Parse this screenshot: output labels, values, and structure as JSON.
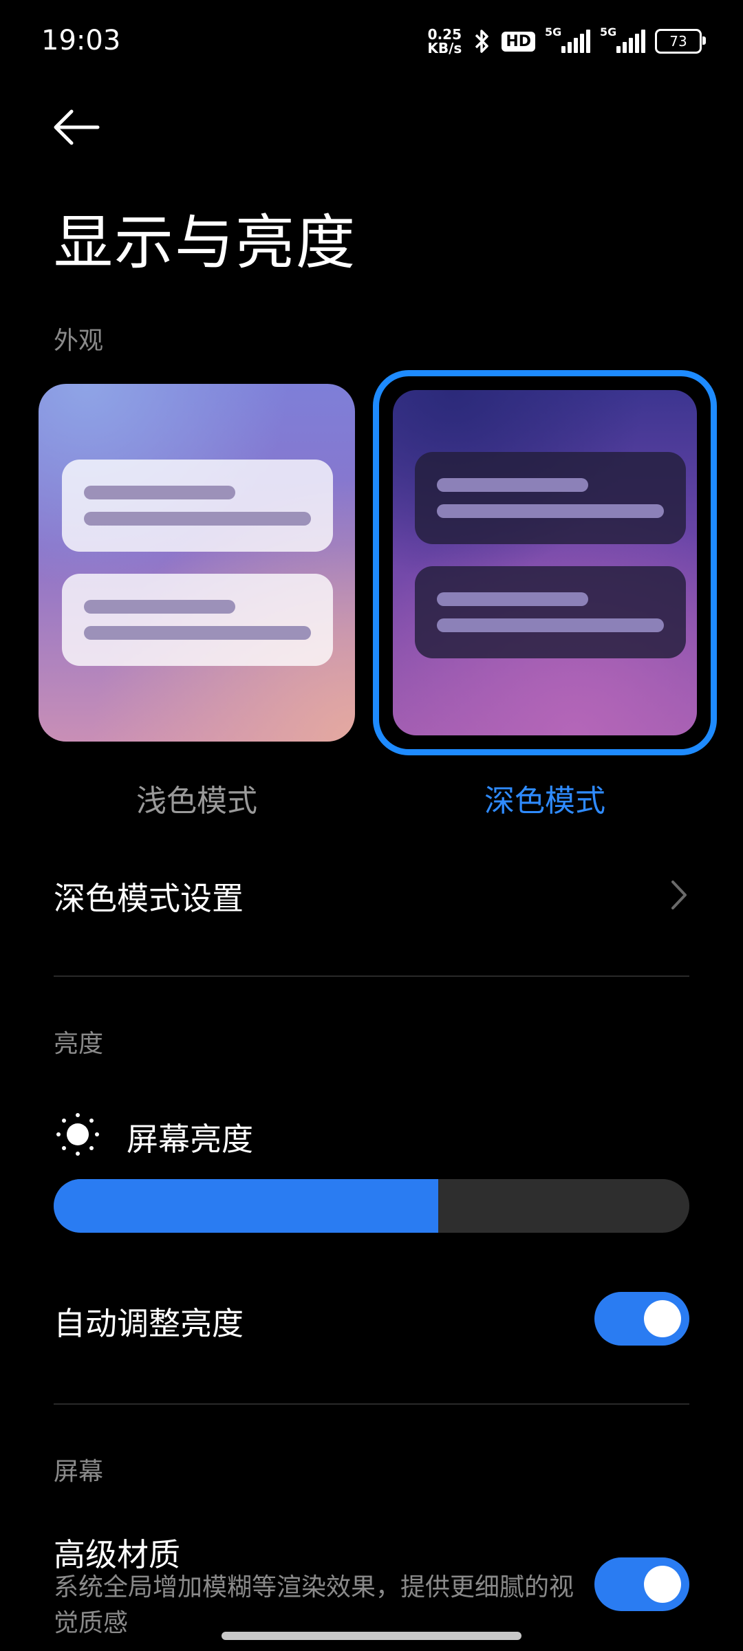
{
  "status_bar": {
    "time": "19:03",
    "speed_value": "0.25",
    "speed_unit": "KB/s",
    "hd_badge": "HD",
    "sim1_label": "5G",
    "sim2_label": "5G",
    "battery": "73"
  },
  "header": {
    "title": "显示与亮度"
  },
  "appearance": {
    "section_label": "外观",
    "light_mode_label": "浅色模式",
    "dark_mode_label": "深色模式",
    "selected": "dark",
    "accent_color": "#1e8bff"
  },
  "dark_mode_settings": {
    "label": "深色模式设置"
  },
  "brightness": {
    "section_label": "亮度",
    "screen_brightness_label": "屏幕亮度",
    "level": 0.605,
    "auto_label": "自动调整亮度",
    "auto_enabled": true
  },
  "screen": {
    "section_label": "屏幕",
    "advanced_material_label": "高级材质",
    "advanced_material_desc": "系统全局增加模糊等渲染效果，提供更细腻的视觉质感",
    "advanced_material_enabled": true
  },
  "icons": {
    "back": "arrow-left-icon",
    "chevron": "chevron-right-icon",
    "sun": "sun-icon",
    "bluetooth": "bluetooth-icon"
  }
}
